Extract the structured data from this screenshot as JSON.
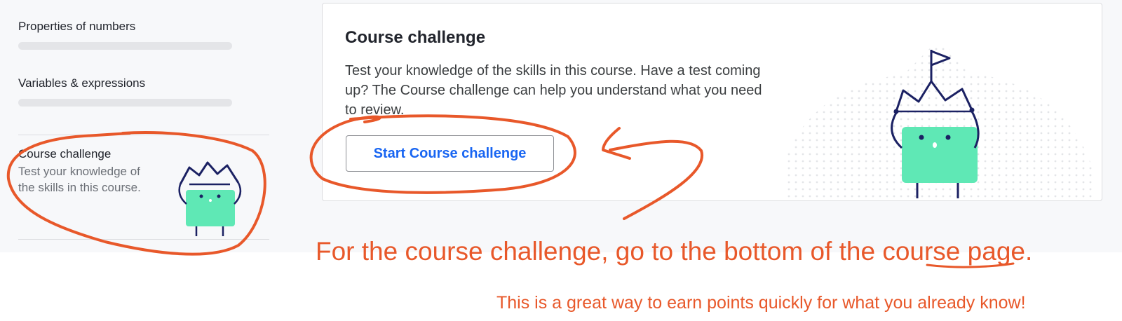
{
  "sidebar": {
    "units": [
      {
        "title": "Properties of numbers",
        "progress": 0
      },
      {
        "title": "Variables & expressions",
        "progress": 0
      }
    ],
    "challenge": {
      "title": "Course challenge",
      "description": "Test your knowledge of the skills in this course."
    }
  },
  "card": {
    "title": "Course challenge",
    "description": "Test your knowledge of the skills in this course. Have a test coming up? The Course challenge can help you understand what you need to review.",
    "button_label": "Start Course challenge"
  },
  "annotations": {
    "main_note": "For the course challenge, go to the bottom of the course page.",
    "sub_note": "This is a great way to earn points quickly for what you already know!"
  },
  "colors": {
    "accent_blue": "#1865f2",
    "mascot_green": "#5fe8b5",
    "mascot_navy": "#1b2163",
    "annotation_orange": "#e8582a"
  },
  "icons": [
    "crowned-mascot-icon",
    "flag-icon"
  ]
}
